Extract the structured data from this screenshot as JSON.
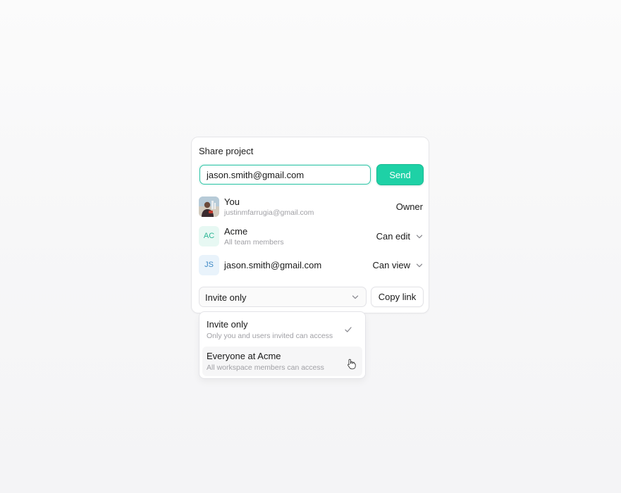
{
  "panel": {
    "title": "Share project",
    "email_input": {
      "value": "jason.smith@gmail.com",
      "placeholder": ""
    },
    "send_label": "Send",
    "members": [
      {
        "name": "You",
        "subtitle": "justinmfarrugia@gmail.com",
        "role": "Owner",
        "avatar": "photo"
      },
      {
        "name": "Acme",
        "subtitle": "All team members",
        "role": "Can edit",
        "avatar_initials": "AC"
      },
      {
        "name": "jason.smith@gmail.com",
        "subtitle": "",
        "role": "Can view",
        "avatar_initials": "JS"
      }
    ],
    "access_select": {
      "selected": "Invite only"
    },
    "copy_link_label": "Copy link"
  },
  "dropdown": {
    "options": [
      {
        "title": "Invite only",
        "description": "Only you and users invited can access",
        "selected": true
      },
      {
        "title": "Everyone at Acme",
        "description": "All workspace members can access",
        "selected": false
      }
    ]
  },
  "colors": {
    "accent": "#1ed1a6",
    "input_border": "#2ec4a6",
    "ac_avatar_bg": "#e7f8f3",
    "ac_avatar_text": "#2bb594",
    "js_avatar_bg": "#e9f3fb",
    "js_avatar_text": "#3b87c4"
  },
  "icons": {
    "role_dropdown": "chevron-down-icon",
    "select_dropdown": "chevron-down-icon",
    "selected_option": "checkmark-icon",
    "pointer": "hand-pointer-cursor-icon"
  }
}
